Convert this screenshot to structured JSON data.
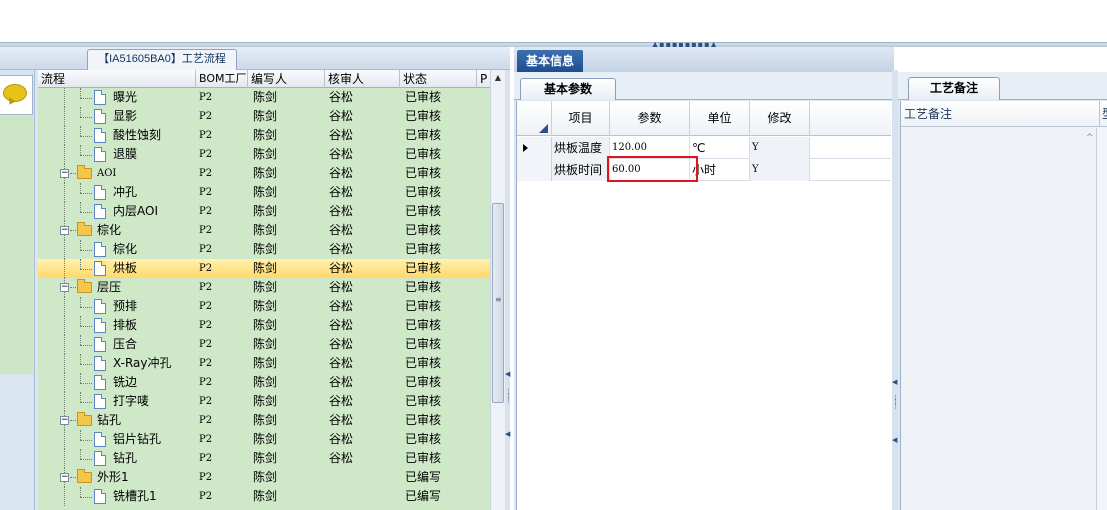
{
  "left_panel": {
    "process_tab_label": "【IA51605BA0】工艺流程",
    "columns": [
      "流程",
      "BOM工厂",
      "编写人",
      "核审人",
      "状态",
      "P"
    ],
    "rows": [
      {
        "name": "曝光",
        "kind": "doc",
        "depth": 2,
        "bom": "P2",
        "writer": "陈剑",
        "reviewer": "谷松",
        "status": "已审核"
      },
      {
        "name": "显影",
        "kind": "doc",
        "depth": 2,
        "bom": "P2",
        "writer": "陈剑",
        "reviewer": "谷松",
        "status": "已审核"
      },
      {
        "name": "酸性蚀刻",
        "kind": "doc",
        "depth": 2,
        "bom": "P2",
        "writer": "陈剑",
        "reviewer": "谷松",
        "status": "已审核"
      },
      {
        "name": "退膜",
        "kind": "doc",
        "depth": 2,
        "bom": "P2",
        "writer": "陈剑",
        "reviewer": "谷松",
        "status": "已审核"
      },
      {
        "name": "AOI",
        "kind": "folder",
        "depth": 1,
        "bom": "P2",
        "writer": "陈剑",
        "reviewer": "谷松",
        "status": "已审核"
      },
      {
        "name": "冲孔",
        "kind": "doc",
        "depth": 2,
        "bom": "P2",
        "writer": "陈剑",
        "reviewer": "谷松",
        "status": "已审核"
      },
      {
        "name": "内层AOI",
        "kind": "doc",
        "depth": 2,
        "bom": "P2",
        "writer": "陈剑",
        "reviewer": "谷松",
        "status": "已审核"
      },
      {
        "name": "棕化",
        "kind": "folder",
        "depth": 1,
        "bom": "P2",
        "writer": "陈剑",
        "reviewer": "谷松",
        "status": "已审核"
      },
      {
        "name": "棕化",
        "kind": "doc",
        "depth": 2,
        "bom": "P2",
        "writer": "陈剑",
        "reviewer": "谷松",
        "status": "已审核"
      },
      {
        "name": "烘板",
        "kind": "doc",
        "depth": 2,
        "bom": "P2",
        "writer": "陈剑",
        "reviewer": "谷松",
        "status": "已审核",
        "selected": true
      },
      {
        "name": "层压",
        "kind": "folder",
        "depth": 1,
        "bom": "P2",
        "writer": "陈剑",
        "reviewer": "谷松",
        "status": "已审核"
      },
      {
        "name": "预排",
        "kind": "doc",
        "depth": 2,
        "bom": "P2",
        "writer": "陈剑",
        "reviewer": "谷松",
        "status": "已审核"
      },
      {
        "name": "排板",
        "kind": "doc",
        "depth": 2,
        "bom": "P2",
        "writer": "陈剑",
        "reviewer": "谷松",
        "status": "已审核"
      },
      {
        "name": "压合",
        "kind": "doc",
        "depth": 2,
        "bom": "P2",
        "writer": "陈剑",
        "reviewer": "谷松",
        "status": "已审核"
      },
      {
        "name": "X-Ray冲孔",
        "kind": "doc",
        "depth": 2,
        "bom": "P2",
        "writer": "陈剑",
        "reviewer": "谷松",
        "status": "已审核"
      },
      {
        "name": "铣边",
        "kind": "doc",
        "depth": 2,
        "bom": "P2",
        "writer": "陈剑",
        "reviewer": "谷松",
        "status": "已审核"
      },
      {
        "name": "打字唛",
        "kind": "doc",
        "depth": 2,
        "bom": "P2",
        "writer": "陈剑",
        "reviewer": "谷松",
        "status": "已审核"
      },
      {
        "name": "钻孔",
        "kind": "folder",
        "depth": 1,
        "bom": "P2",
        "writer": "陈剑",
        "reviewer": "谷松",
        "status": "已审核"
      },
      {
        "name": "铝片钻孔",
        "kind": "doc",
        "depth": 2,
        "bom": "P2",
        "writer": "陈剑",
        "reviewer": "谷松",
        "status": "已审核"
      },
      {
        "name": "钻孔",
        "kind": "doc",
        "depth": 2,
        "bom": "P2",
        "writer": "陈剑",
        "reviewer": "谷松",
        "status": "已审核"
      },
      {
        "name": "外形1",
        "kind": "folder",
        "depth": 1,
        "bom": "P2",
        "writer": "陈剑",
        "reviewer": "",
        "status": "已编写"
      },
      {
        "name": "铣槽孔1",
        "kind": "doc",
        "depth": 2,
        "bom": "P2",
        "writer": "陈剑",
        "reviewer": "",
        "status": "已编写"
      }
    ]
  },
  "middle_panel": {
    "tab_label": "基本信息",
    "subtab_label": "基本参数",
    "columns": [
      "项目",
      "参数",
      "单位",
      "修改"
    ],
    "rows": [
      {
        "item": "烘板温度",
        "param": "120.00",
        "unit": "℃",
        "modify": "Y",
        "current": true
      },
      {
        "item": "烘板时间",
        "param": "60.00",
        "unit": "小时",
        "modify": "Y",
        "current": false
      }
    ]
  },
  "right_panel": {
    "tab_label": "工艺备注",
    "column_label": "工艺备注",
    "cut_column_label": "型"
  }
}
